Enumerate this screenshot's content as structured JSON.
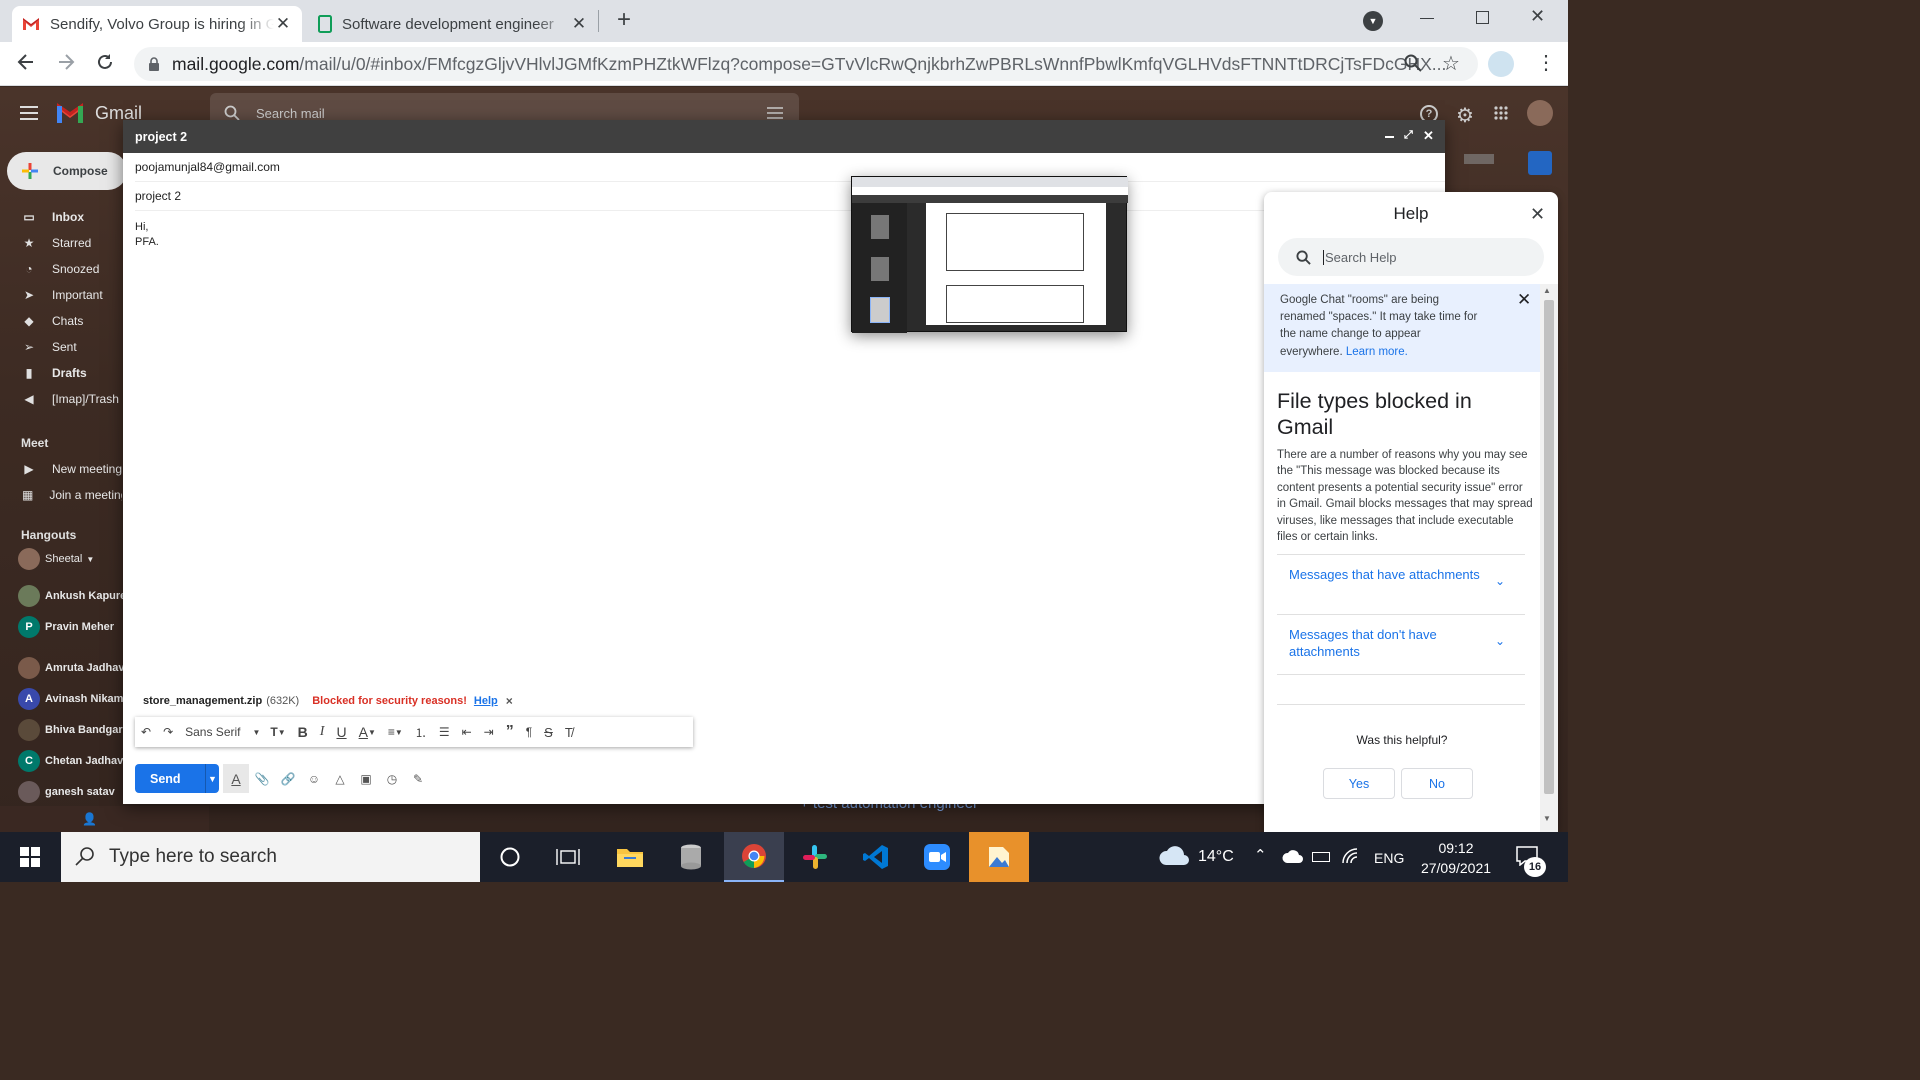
{
  "browser": {
    "tabs": [
      {
        "title": "Sendify, Volvo Group is hiring in Go",
        "active": true
      },
      {
        "title": "Software development engineer",
        "active": false
      }
    ],
    "url_host": "mail.google.com",
    "url_path": "/mail/u/0/#inbox/FMfcgzGljvVHlvlJGMfKzmPHZtkWFlzq?compose=GTvVlcRwQnjkbrhZwPBRLsWnnfPbwlKmfqVGLHVdsFTNNTtDRCjTsFDcGHX..."
  },
  "gmail": {
    "logo_text": "Gmail",
    "search_placeholder": "Search mail",
    "compose_label": "Compose",
    "nav": [
      {
        "label": "Inbox",
        "icon": "inbox-icon"
      },
      {
        "label": "Starred",
        "icon": "star-icon"
      },
      {
        "label": "Snoozed",
        "icon": "clock-icon"
      },
      {
        "label": "Important",
        "icon": "important-icon"
      },
      {
        "label": "Chats",
        "icon": "chat-icon"
      },
      {
        "label": "Sent",
        "icon": "send-icon"
      },
      {
        "label": "Drafts",
        "icon": "draft-icon"
      },
      {
        "label": "[Imap]/Trash",
        "icon": "label-icon"
      }
    ],
    "meet_title": "Meet",
    "meet_items": [
      "New meeting",
      "Join a meeting"
    ],
    "hangouts_title": "Hangouts",
    "hangouts_me": "Sheetal",
    "contacts": [
      {
        "name": "Ankush Kapure",
        "initial": "",
        "color": "#6b7a5a"
      },
      {
        "name": "Pravin Meher",
        "initial": "P",
        "color": "#00796b"
      },
      {
        "name": "Amruta Jadhav",
        "initial": "",
        "color": "#7a5a4a"
      },
      {
        "name": "Avinash Nikam",
        "initial": "A",
        "color": "#3949ab"
      },
      {
        "name": "Bhiva Bandgar",
        "initial": "",
        "color": "#5a4a3a"
      },
      {
        "name": "Chetan Jadhav",
        "initial": "C",
        "color": "#00796b"
      },
      {
        "name": "ganesh satav",
        "initial": "",
        "color": "#6a5a5a"
      }
    ],
    "bg_link": "+ test automation engineer"
  },
  "compose": {
    "title": "project 2",
    "to": "poojamunjal84@gmail.com",
    "subject": "project 2",
    "body_line1": "Hi,",
    "body_line2": "PFA.",
    "attachment_name": "store_management.zip",
    "attachment_size": "(632K)",
    "blocked_text": "Blocked for security reasons!",
    "help_link": "Help",
    "font_name": "Sans Serif",
    "send_label": "Send"
  },
  "help": {
    "title": "Help",
    "search_placeholder": "Search Help",
    "banner_text": "Google Chat \"rooms\" are being renamed \"spaces.\" It may take time for the name change to appear everywhere.",
    "banner_link": "Learn more.",
    "article_title": "File types blocked in Gmail",
    "article_body": "There are a number of reasons why you may see the \"This message was blocked because its content presents a potential security issue\" error in Gmail. Gmail blocks messages that may spread viruses, like messages that include executable files or certain links.",
    "accordions": [
      "Messages that have attachments",
      "Messages that don't have attachments"
    ],
    "helpful_question": "Was this helpful?",
    "yes": "Yes",
    "no": "No"
  },
  "taskbar": {
    "search_placeholder": "Type here to search",
    "temperature": "14°C",
    "language": "ENG",
    "time": "09:12",
    "date": "27/09/2021",
    "notifications": "16"
  }
}
